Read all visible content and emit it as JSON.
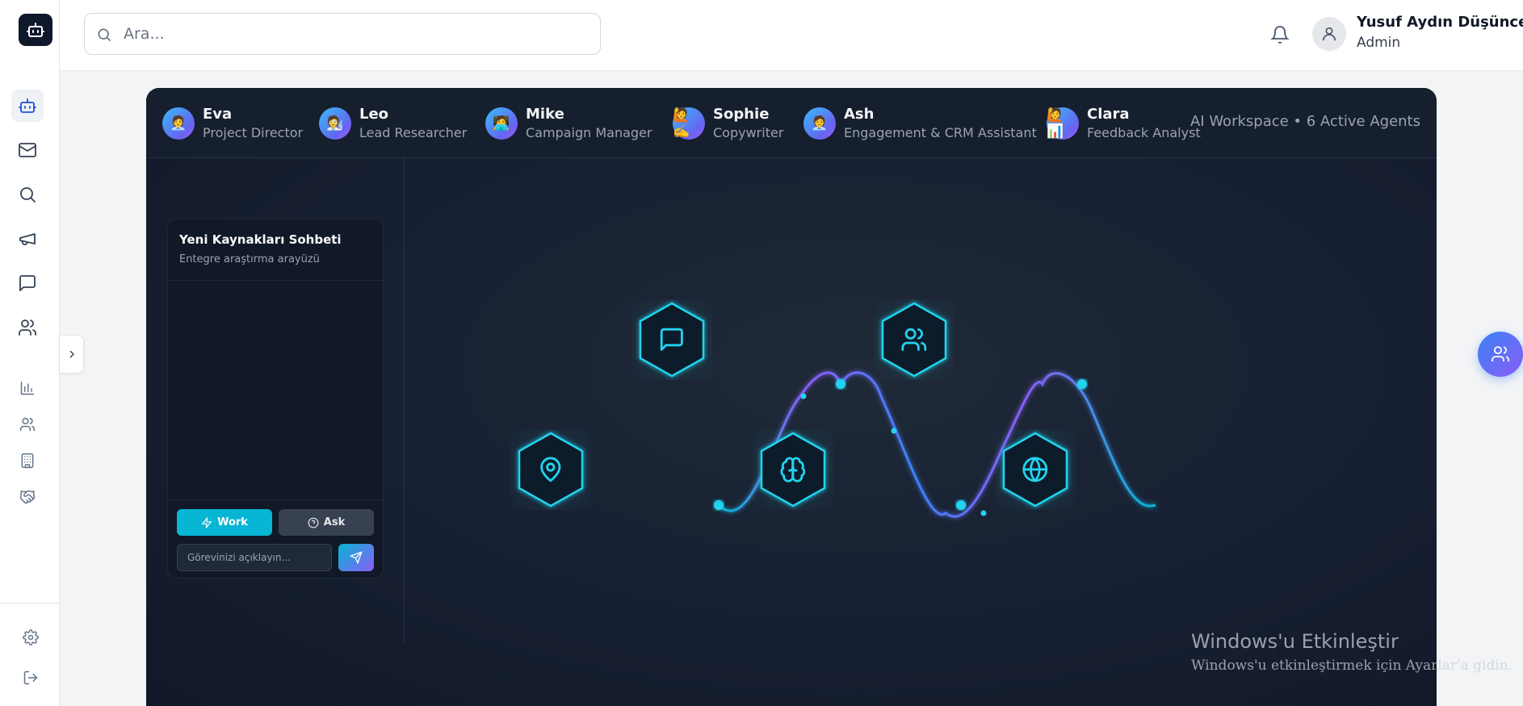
{
  "header": {
    "search_placeholder": "Ara...",
    "user_name": "Yusuf Aydın Düşünceli",
    "user_role": "Admin"
  },
  "sidebar": {
    "items": [
      {
        "icon": "bot-icon",
        "active": true
      },
      {
        "icon": "mail-icon"
      },
      {
        "icon": "search-icon"
      },
      {
        "icon": "megaphone-icon"
      },
      {
        "icon": "chat-icon"
      },
      {
        "icon": "users-icon"
      },
      {
        "icon": "bar-chart-icon"
      },
      {
        "icon": "users-icon"
      },
      {
        "icon": "building-icon"
      },
      {
        "icon": "handshake-icon"
      }
    ],
    "bottom": [
      {
        "icon": "gear-icon"
      },
      {
        "icon": "logout-icon"
      }
    ]
  },
  "agents": [
    {
      "name": "Eva",
      "role": "Project Director",
      "emoji": "🧑‍💼"
    },
    {
      "name": "Leo",
      "role": "Lead Researcher",
      "emoji": "🧑‍🔬"
    },
    {
      "name": "Mike",
      "role": "Campaign Manager",
      "emoji": "🧑‍💻"
    },
    {
      "name": "Sophie",
      "role": "Copywriter",
      "emoji": "🙋✍️"
    },
    {
      "name": "Ash",
      "role": "Engagement & CRM Assistant",
      "emoji": "🧑‍💼"
    },
    {
      "name": "Clara",
      "role": "Feedback Analyst",
      "emoji": "🙋📊"
    }
  ],
  "workspace_status": "AI Workspace • 6 Active Agents",
  "chat": {
    "title": "Yeni Kaynakları Sohbeti",
    "subtitle": "Entegre araştırma arayüzü",
    "work_label": "Work",
    "ask_label": "Ask",
    "input_placeholder": "Görevinizi açıklayın..."
  },
  "visualization": {
    "nodes": [
      "location-pin-icon",
      "chat-bubble-icon",
      "brain-icon",
      "users-icon",
      "globe-icon"
    ],
    "accent": "#22d3ee",
    "wave_colors": [
      "#06b6d4",
      "#8b5cf6"
    ]
  },
  "windows_watermark": {
    "title": "Windows'u Etkinleştir",
    "subtitle": "Windows'u etkinleştirmek için Ayarlar'a gidin."
  }
}
